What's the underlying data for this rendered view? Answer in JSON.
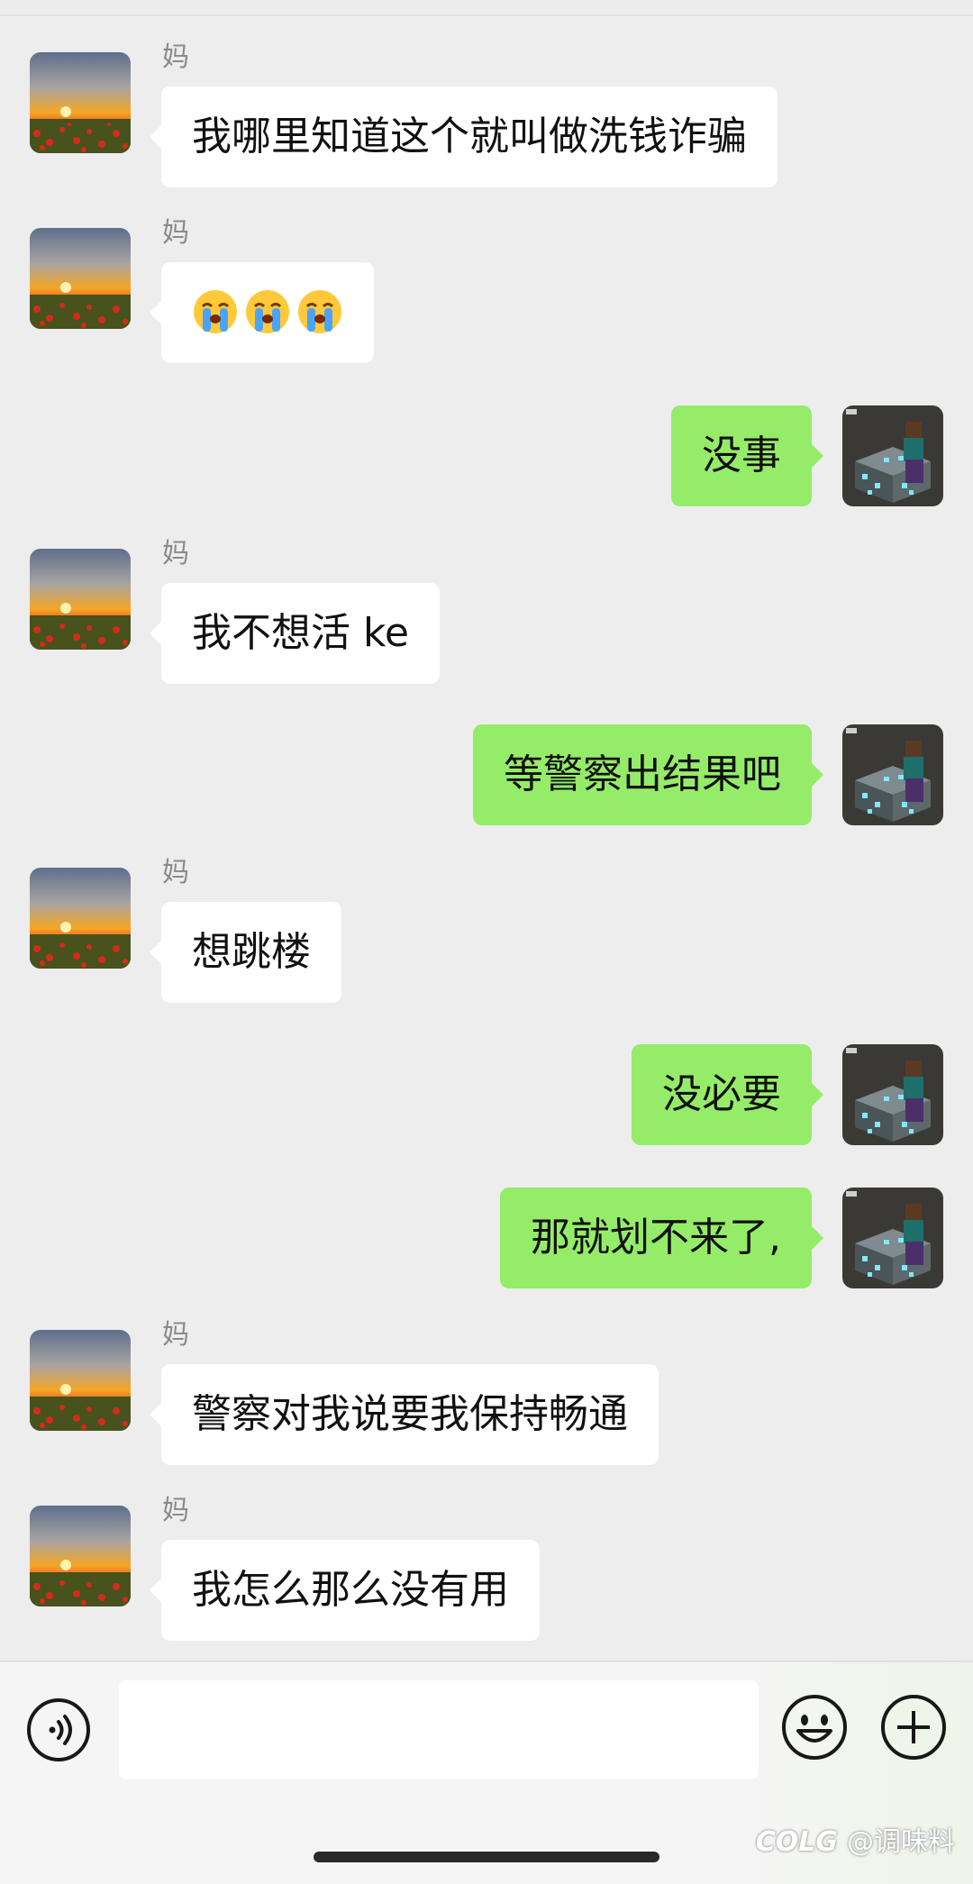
{
  "contact_name": "妈",
  "messages": [
    {
      "side": "left",
      "sender": "妈",
      "text": "我哪里知道这个就叫做洗钱诈骗"
    },
    {
      "side": "left",
      "sender": "妈",
      "emojis": [
        "crying-face",
        "crying-face",
        "crying-face"
      ]
    },
    {
      "side": "right",
      "text": "没事"
    },
    {
      "side": "left",
      "sender": "妈",
      "text": "我不想活 ke"
    },
    {
      "side": "right",
      "text": "等警察出结果吧"
    },
    {
      "side": "left",
      "sender": "妈",
      "text": "想跳楼"
    },
    {
      "side": "right",
      "text": "没必要"
    },
    {
      "side": "right",
      "text": "那就划不来了,"
    },
    {
      "side": "left",
      "sender": "妈",
      "text": "警察对我说要我保持畅通"
    },
    {
      "side": "left",
      "sender": "妈",
      "text": "我怎么那么没有用"
    }
  ],
  "input_bar": {
    "voice_icon": "voice-icon",
    "emoji_icon": "smiley-icon",
    "plus_icon": "plus-icon",
    "input_value": ""
  },
  "watermark": {
    "logo": "COLG",
    "handle": "@调味料"
  },
  "colors": {
    "background": "#ededed",
    "sent_bubble": "#95ec69",
    "received_bubble": "#ffffff"
  }
}
